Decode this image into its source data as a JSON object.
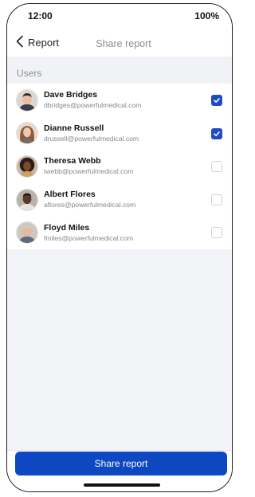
{
  "status_bar": {
    "time": "12:00",
    "battery": "100%"
  },
  "nav": {
    "back_label": "Report",
    "title": "Share report"
  },
  "section": {
    "title": "Users"
  },
  "users": [
    {
      "name": "Dave Bridges",
      "email": "dbridges@powerfulmedical.com",
      "checked": true
    },
    {
      "name": "Dianne Russell",
      "email": "drussell@powerfulmedical.com",
      "checked": true
    },
    {
      "name": "Theresa Webb",
      "email": "twebb@powerfulmedical.com",
      "checked": false
    },
    {
      "name": "Albert Flores",
      "email": "aflores@powerfulmedical.com",
      "checked": false
    },
    {
      "name": "Floyd Miles",
      "email": "fmiles@powerfulmedical.com",
      "checked": false
    }
  ],
  "footer": {
    "share_label": "Share report"
  },
  "colors": {
    "accent": "#0e47c2",
    "checkbox_checked": "#1f4cc4"
  },
  "icons": {
    "back": "chevron-left-icon",
    "checkbox_checked": "checkmark-icon",
    "avatar": "user-photo"
  }
}
